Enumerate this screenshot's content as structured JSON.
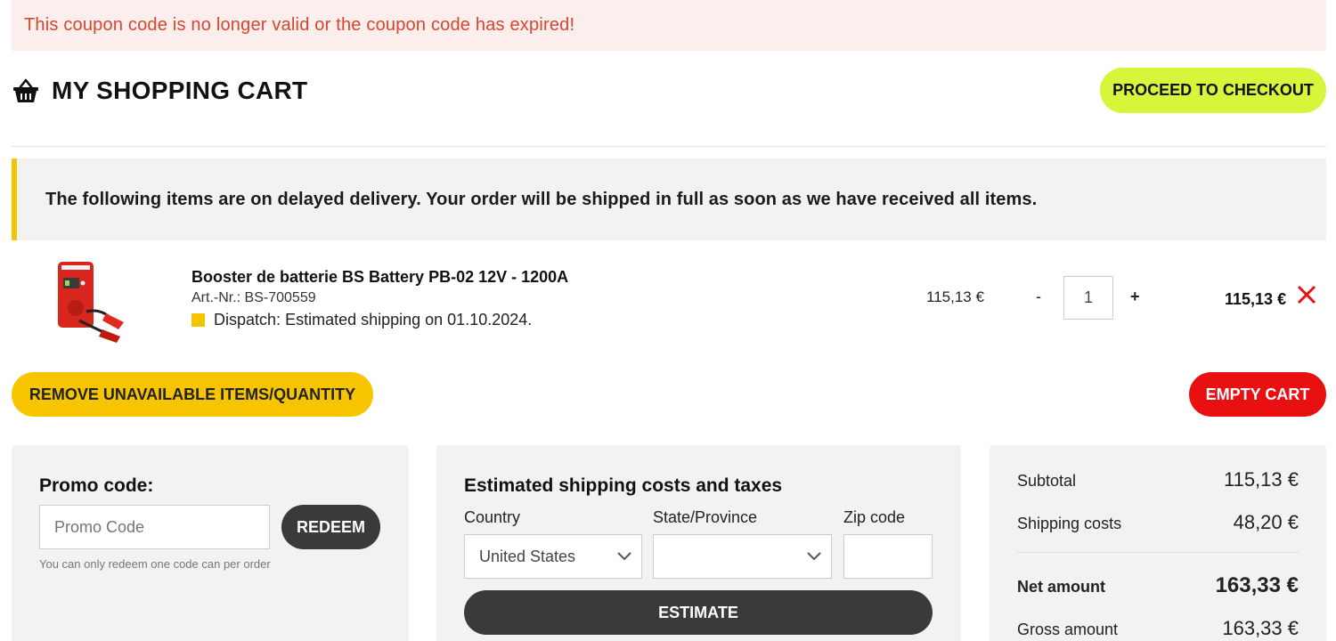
{
  "alert": {
    "message": "This coupon code is no longer valid or the coupon code has expired!"
  },
  "header": {
    "title": "MY SHOPPING CART",
    "basket_icon": "basket-icon",
    "checkout_label": "PROCEED TO CHECKOUT",
    "checkout_color": "#d8f53c"
  },
  "notice": {
    "text": "The following items are on delayed delivery. Your order will be shipped in full as soon as we have received all items.",
    "accent_color": "#f5c400"
  },
  "cart_item": {
    "name": "Booster de batterie BS Battery PB-02 12V - 1200A",
    "article": "Art.-Nr.: BS-700559",
    "dispatch_label": "Dispatch:",
    "dispatch_text": "Estimated shipping on 01.10.2024.",
    "unit_price": "115,13 €",
    "qty_minus": "-",
    "quantity": "1",
    "qty_plus": "+",
    "line_total": "115,13 €",
    "remove_icon": "close-icon"
  },
  "actions": {
    "remove_unavailable_label": "REMOVE UNAVAILABLE ITEMS/QUANTITY",
    "empty_cart_label": "EMPTY CART",
    "empty_cart_color": "#e81010"
  },
  "promo": {
    "title": "Promo code:",
    "placeholder": "Promo Code",
    "redeem_label": "REDEEM",
    "hint": "You can only redeem one code can per order"
  },
  "shipping": {
    "title": "Estimated shipping costs and taxes",
    "country_label": "Country",
    "country_value": "United States",
    "state_label": "State/Province",
    "state_value": "",
    "zip_label": "Zip code",
    "zip_value": "",
    "estimate_label": "ESTIMATE"
  },
  "summary": {
    "subtotal_label": "Subtotal",
    "subtotal_value": "115,13 €",
    "shipping_label": "Shipping costs",
    "shipping_value": "48,20 €",
    "net_label": "Net amount",
    "net_value": "163,33 €",
    "gross_label": "Gross amount",
    "gross_value": "163,33 €"
  }
}
